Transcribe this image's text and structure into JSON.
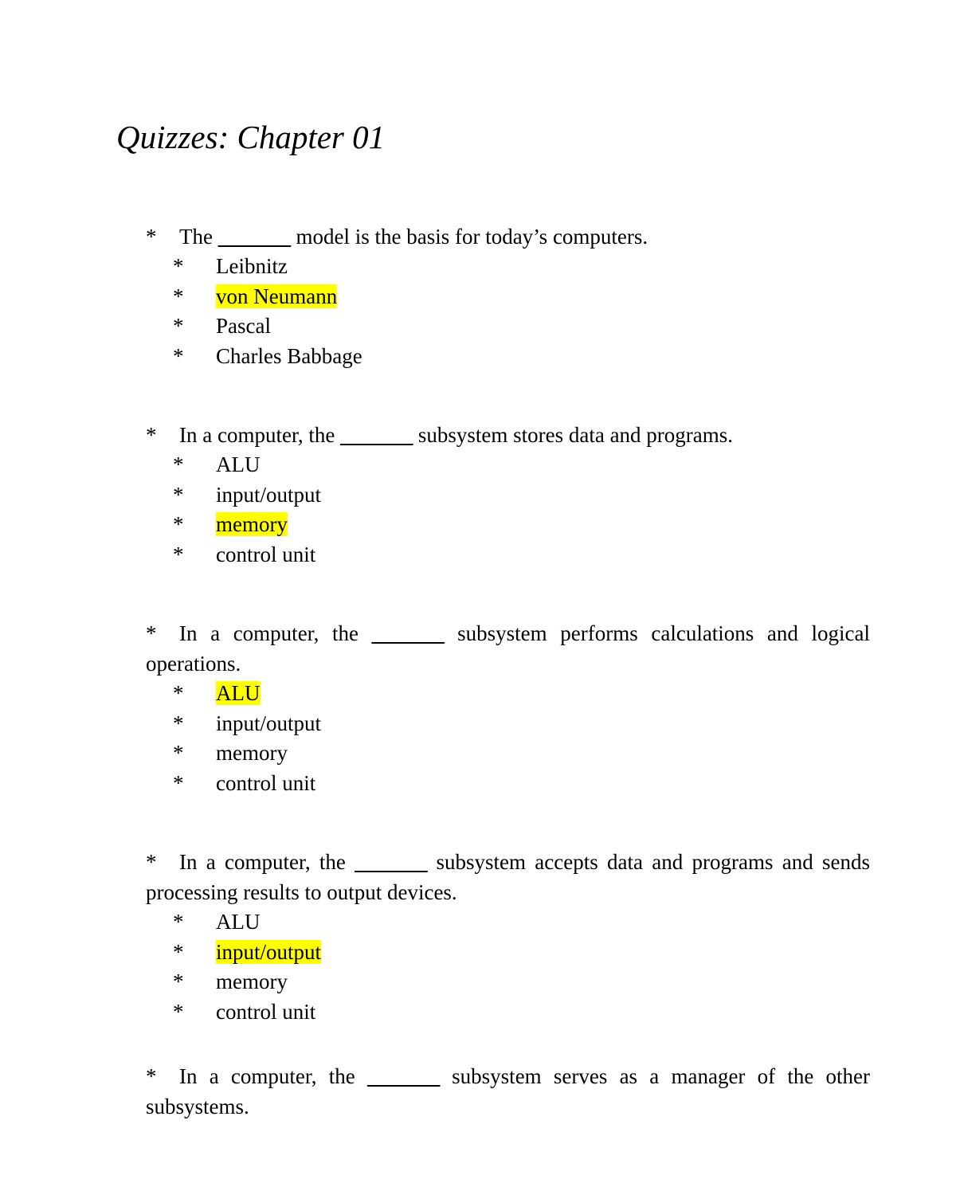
{
  "document": {
    "title": "Quizzes: Chapter 01",
    "bullet_marker": "*",
    "blank_placeholder": "_______",
    "highlight_color": "#ffff00",
    "text_color": "#000000",
    "page_background": "#ffffff"
  },
  "questions": [
    {
      "id": "q1",
      "marker": "*",
      "text_before_blank": "The ",
      "blank": "_______",
      "text_after_blank": " model is the basis for today’s computers.",
      "justified": false,
      "options": [
        {
          "marker": "*",
          "label": "Leibnitz",
          "highlighted": false
        },
        {
          "marker": "*",
          "label": "von Neumann",
          "highlighted": true
        },
        {
          "marker": "*",
          "label": "Pascal",
          "highlighted": false
        },
        {
          "marker": "*",
          "label": "Charles Babbage",
          "highlighted": false
        }
      ]
    },
    {
      "id": "q2",
      "marker": "*",
      "text_before_blank": "In a computer, the ",
      "blank": "_______",
      "text_after_blank": " subsystem stores data and programs.",
      "justified": false,
      "options": [
        {
          "marker": "*",
          "label": "ALU",
          "highlighted": false
        },
        {
          "marker": "*",
          "label": "input/output",
          "highlighted": false
        },
        {
          "marker": "*",
          "label": "memory",
          "highlighted": true
        },
        {
          "marker": "*",
          "label": "control unit",
          "highlighted": false
        }
      ]
    },
    {
      "id": "q3",
      "marker": "*",
      "text_before_blank": "In a computer, the ",
      "blank": "_______",
      "text_after_blank": " subsystem performs calculations and logical operations.",
      "justified": true,
      "options": [
        {
          "marker": "*",
          "label": "ALU",
          "highlighted": true
        },
        {
          "marker": "*",
          "label": "input/output",
          "highlighted": false
        },
        {
          "marker": "*",
          "label": "memory",
          "highlighted": false
        },
        {
          "marker": "*",
          "label": "control unit",
          "highlighted": false
        }
      ]
    },
    {
      "id": "q4",
      "marker": "*",
      "text_before_blank": "In a computer, the ",
      "blank": "_______",
      "text_after_blank": " subsystem accepts data and programs and sends processing results to output devices.",
      "justified": true,
      "options": [
        {
          "marker": "*",
          "label": "ALU",
          "highlighted": false
        },
        {
          "marker": "*",
          "label": "input/output",
          "highlighted": true
        },
        {
          "marker": "*",
          "label": "memory",
          "highlighted": false
        },
        {
          "marker": "*",
          "label": "control unit",
          "highlighted": false
        }
      ]
    },
    {
      "id": "q5",
      "marker": "*",
      "text_before_blank": "In a computer, the ",
      "blank": "_______",
      "text_after_blank": " subsystem serves as a manager of the other subsystems.",
      "justified": true,
      "options": []
    }
  ]
}
